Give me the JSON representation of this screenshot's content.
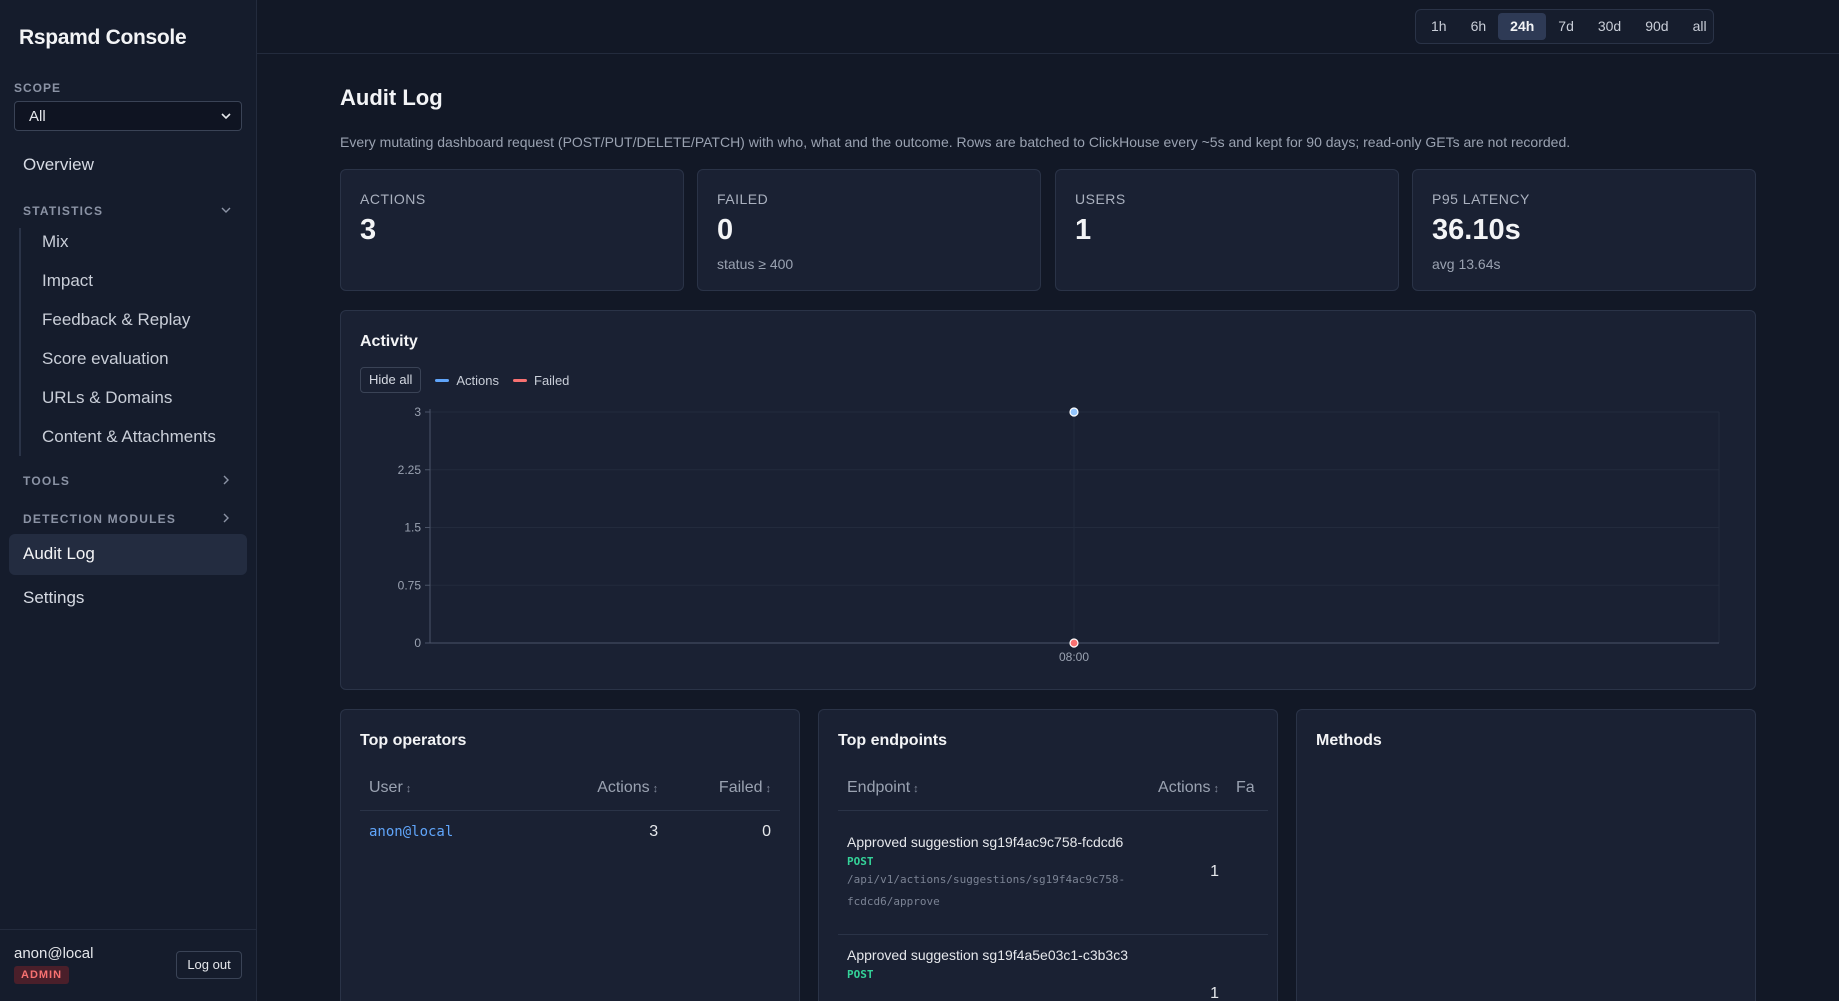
{
  "app": {
    "title": "Rspamd Console"
  },
  "scope": {
    "label": "SCOPE",
    "value": "All"
  },
  "nav": {
    "overview": "Overview",
    "statistics": {
      "label": "STATISTICS",
      "items": [
        "Mix",
        "Impact",
        "Feedback & Replay",
        "Score evaluation",
        "URLs & Domains",
        "Content & Attachments"
      ]
    },
    "tools": "TOOLS",
    "detection_modules": "DETECTION MODULES",
    "audit_log": "Audit Log",
    "settings": "Settings"
  },
  "footer": {
    "user": "anon@local",
    "role": "ADMIN",
    "logout": "Log out"
  },
  "time_ranges": {
    "options": [
      "1h",
      "6h",
      "24h",
      "7d",
      "30d",
      "90d",
      "all"
    ],
    "selected": "24h"
  },
  "page": {
    "title": "Audit Log",
    "description": "Every mutating dashboard request (POST/PUT/DELETE/PATCH) with who, what and the outcome. Rows are batched to ClickHouse every ~5s and kept for 90 days; read-only GETs are not recorded."
  },
  "stats": {
    "actions": {
      "label": "ACTIONS",
      "value": "3"
    },
    "failed": {
      "label": "FAILED",
      "value": "0",
      "sub": "status ≥ 400"
    },
    "users": {
      "label": "USERS",
      "value": "1"
    },
    "latency": {
      "label": "P95 LATENCY",
      "value": "36.10s",
      "sub": "avg 13.64s"
    }
  },
  "activity": {
    "title": "Activity",
    "hide_all": "Hide all",
    "legend": {
      "actions": "Actions",
      "failed": "Failed"
    }
  },
  "chart_data": {
    "type": "line",
    "x": [
      "08:00"
    ],
    "series": [
      {
        "name": "Actions",
        "values": [
          3
        ],
        "color": "#93c5fd"
      },
      {
        "name": "Failed",
        "values": [
          0
        ],
        "color": "#f87171"
      }
    ],
    "ylim": [
      0,
      3
    ],
    "yticks": [
      "3",
      "2.25",
      "1.5",
      "0.75",
      "0"
    ],
    "xticks": [
      "08:00"
    ],
    "grid": true,
    "legend_position": "top-left"
  },
  "top_operators": {
    "title": "Top operators",
    "columns": {
      "user": "User",
      "actions": "Actions",
      "failed": "Failed"
    },
    "rows": [
      {
        "user": "anon@local",
        "actions": "3",
        "failed": "0"
      }
    ]
  },
  "top_endpoints": {
    "title": "Top endpoints",
    "columns": {
      "endpoint": "Endpoint",
      "actions": "Actions",
      "failed": "Fa"
    },
    "rows": [
      {
        "title": "Approved suggestion sg19f4ac9c758-fcdcd6",
        "method": "POST",
        "path": "/api/v1/actions/suggestions/sg19f4ac9c758-fcdcd6/approve",
        "actions": "1"
      },
      {
        "title": "Approved suggestion sg19f4a5e03c1-c3b3c3",
        "method": "POST",
        "path": "",
        "actions": "1"
      }
    ]
  },
  "methods": {
    "title": "Methods"
  },
  "icons": {
    "select_chevron": "chevron-down-icon",
    "sort": "sort-icon",
    "section_collapse": "chevron-down-icon",
    "section_expand": "chevron-right-icon"
  },
  "colors": {
    "accent": "#60a5fa",
    "actions_series": "#93c5fd",
    "failed_series": "#f87171",
    "post_method": "#34d399",
    "admin_badge": "#f87171"
  }
}
